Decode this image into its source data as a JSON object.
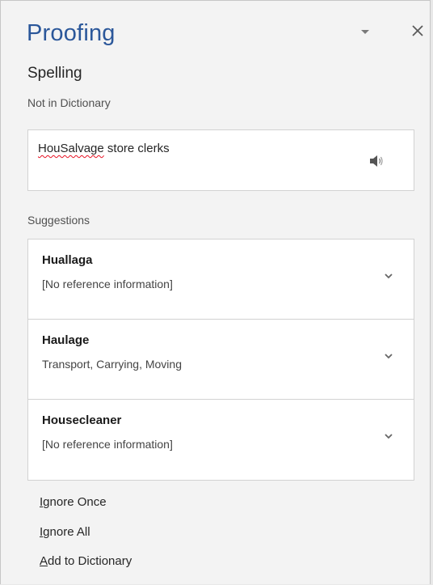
{
  "pane": {
    "title": "Proofing",
    "heading": "Spelling",
    "status": "Not in Dictionary"
  },
  "context": {
    "misspelled_word": "HouSalvage",
    "rest_text": " store clerks"
  },
  "suggestions": {
    "label": "Suggestions",
    "items": [
      {
        "word": "Huallaga",
        "description": "[No reference information]"
      },
      {
        "word": "Haulage",
        "description": "Transport, Carrying, Moving"
      },
      {
        "word": "Housecleaner",
        "description": "[No reference information]"
      }
    ]
  },
  "actions": {
    "ignore_once": {
      "accel": "I",
      "rest": "gnore Once"
    },
    "ignore_all": {
      "accel": "I",
      "rest": "gnore All"
    },
    "add_to_dictionary": {
      "accel": "A",
      "rest": "dd to Dictionary"
    }
  },
  "icons": {
    "dropdown": "triangle-down-icon",
    "close": "close-icon",
    "speaker": "speaker-icon",
    "expand": "chevron-down-icon"
  },
  "colors": {
    "title": "#2b579a",
    "misspelling_underline": "#e81123",
    "pane_background": "#f3f3f3"
  }
}
